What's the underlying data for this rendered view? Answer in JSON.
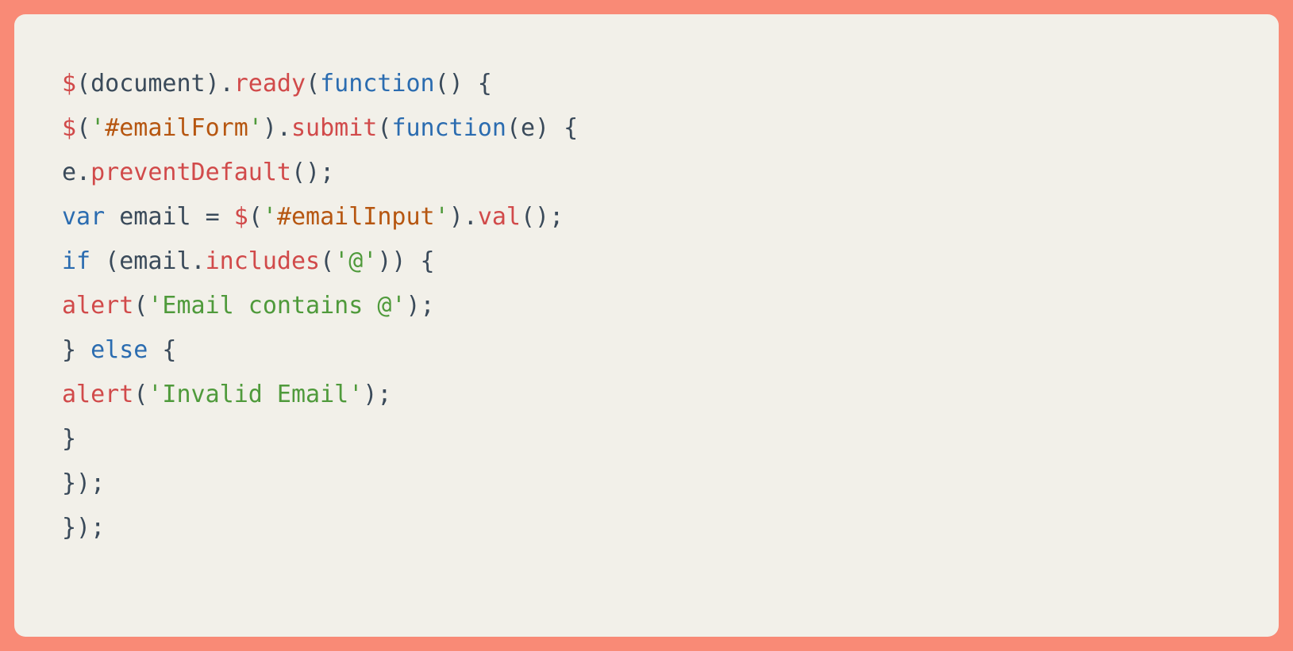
{
  "code": {
    "lines": [
      {
        "tokens": [
          {
            "t": "$",
            "c": "red"
          },
          {
            "t": "(",
            "c": "def"
          },
          {
            "t": "document",
            "c": "def"
          },
          {
            "t": ").",
            "c": "def"
          },
          {
            "t": "ready",
            "c": "red"
          },
          {
            "t": "(",
            "c": "def"
          },
          {
            "t": "function",
            "c": "blue"
          },
          {
            "t": "() {",
            "c": "def"
          }
        ]
      },
      {
        "tokens": [
          {
            "t": "$",
            "c": "red"
          },
          {
            "t": "(",
            "c": "def"
          },
          {
            "t": "'",
            "c": "grn"
          },
          {
            "t": "#emailForm",
            "c": "tag"
          },
          {
            "t": "'",
            "c": "grn"
          },
          {
            "t": ").",
            "c": "def"
          },
          {
            "t": "submit",
            "c": "red"
          },
          {
            "t": "(",
            "c": "def"
          },
          {
            "t": "function",
            "c": "blue"
          },
          {
            "t": "(e) {",
            "c": "def"
          }
        ]
      },
      {
        "tokens": [
          {
            "t": "e.",
            "c": "def"
          },
          {
            "t": "preventDefault",
            "c": "red"
          },
          {
            "t": "();",
            "c": "def"
          }
        ]
      },
      {
        "tokens": [
          {
            "t": "var",
            "c": "blue"
          },
          {
            "t": " email = ",
            "c": "def"
          },
          {
            "t": "$",
            "c": "red"
          },
          {
            "t": "(",
            "c": "def"
          },
          {
            "t": "'",
            "c": "grn"
          },
          {
            "t": "#emailInput",
            "c": "tag"
          },
          {
            "t": "'",
            "c": "grn"
          },
          {
            "t": ").",
            "c": "def"
          },
          {
            "t": "val",
            "c": "red"
          },
          {
            "t": "();",
            "c": "def"
          }
        ]
      },
      {
        "tokens": [
          {
            "t": "if",
            "c": "blue"
          },
          {
            "t": " (email.",
            "c": "def"
          },
          {
            "t": "includes",
            "c": "red"
          },
          {
            "t": "(",
            "c": "def"
          },
          {
            "t": "'@'",
            "c": "grn"
          },
          {
            "t": ")) {",
            "c": "def"
          }
        ]
      },
      {
        "tokens": [
          {
            "t": "alert",
            "c": "red"
          },
          {
            "t": "(",
            "c": "def"
          },
          {
            "t": "'Email contains @'",
            "c": "grn"
          },
          {
            "t": ");",
            "c": "def"
          }
        ]
      },
      {
        "tokens": [
          {
            "t": "} ",
            "c": "def"
          },
          {
            "t": "else",
            "c": "blue"
          },
          {
            "t": " {",
            "c": "def"
          }
        ]
      },
      {
        "tokens": [
          {
            "t": "alert",
            "c": "red"
          },
          {
            "t": "(",
            "c": "def"
          },
          {
            "t": "'Invalid Email'",
            "c": "grn"
          },
          {
            "t": ");",
            "c": "def"
          }
        ]
      },
      {
        "tokens": [
          {
            "t": "}",
            "c": "def"
          }
        ]
      },
      {
        "tokens": [
          {
            "t": "});",
            "c": "def"
          }
        ]
      },
      {
        "tokens": [
          {
            "t": "});",
            "c": "def"
          }
        ]
      }
    ]
  },
  "colors": {
    "frame": "#f98a76",
    "panel": "#f2f0e9",
    "def": "#3a4a5a",
    "red": "#d14a4a",
    "blue": "#2b6cb0",
    "grn": "#4f9a3b",
    "tag": "#b65610"
  }
}
